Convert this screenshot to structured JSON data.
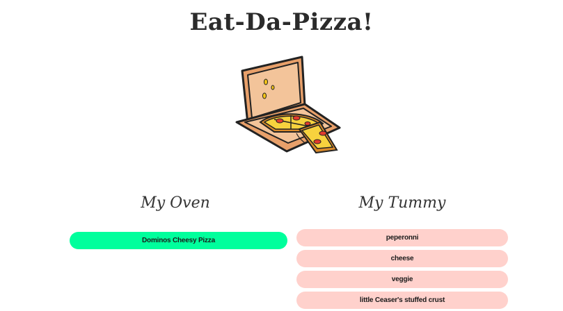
{
  "header": {
    "title": "Eat-Da-Pizza!"
  },
  "illustration": {
    "icon": "pizza-box-icon"
  },
  "oven": {
    "heading": "My Oven",
    "items": [
      "Dominos Cheesy Pizza"
    ],
    "item_color": "#00ff9c"
  },
  "tummy": {
    "heading": "My Tummy",
    "items": [
      "peperonni",
      "cheese",
      "veggie",
      "little Ceaser's stuffed crust"
    ],
    "item_color": "#ffd1cc"
  }
}
